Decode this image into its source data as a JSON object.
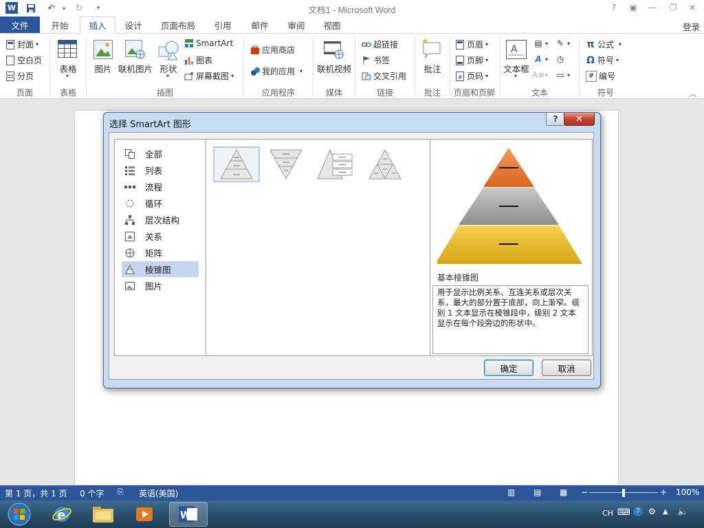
{
  "window": {
    "title": "文档1 - Microsoft Word",
    "controls": [
      "?",
      "▣",
      "—",
      "❐",
      "✕"
    ]
  },
  "tabs": {
    "file": "文件",
    "items": [
      "开始",
      "插入",
      "设计",
      "页面布局",
      "引用",
      "邮件",
      "审阅",
      "视图"
    ],
    "active": "插入",
    "login": "登录"
  },
  "ribbon": {
    "pages": {
      "cover": "封面",
      "blank": "空白页",
      "break": "分页",
      "label": "页面"
    },
    "tables": {
      "table": "表格",
      "label": "表格"
    },
    "illustrations": {
      "picture": "图片",
      "online_picture": "联机图片",
      "shapes": "形状",
      "smartart": "SmartArt",
      "chart": "图表",
      "screenshot": "屏幕截图",
      "label": "插图"
    },
    "apps": {
      "store": "应用商店",
      "myapps": "我的应用",
      "label": "应用程序"
    },
    "media": {
      "online_video": "联机视频",
      "label": "媒体"
    },
    "links": {
      "hyperlink": "超链接",
      "bookmark": "书签",
      "crossref": "交叉引用",
      "label": "链接"
    },
    "comments": {
      "comment": "批注",
      "label": "批注"
    },
    "header_footer": {
      "header": "页眉",
      "footer": "页脚",
      "page_number": "页码",
      "label": "页眉和页脚"
    },
    "text": {
      "textbox": "文本框",
      "label": "文本"
    },
    "symbols": {
      "equation": "公式",
      "symbol": "符号",
      "number": "编号",
      "label": "符号"
    }
  },
  "dialog": {
    "title": "选择 SmartArt 图形",
    "categories": [
      {
        "label": "全部",
        "icon": "all-icon"
      },
      {
        "label": "列表",
        "icon": "list-icon"
      },
      {
        "label": "流程",
        "icon": "process-icon"
      },
      {
        "label": "循环",
        "icon": "cycle-icon"
      },
      {
        "label": "层次结构",
        "icon": "hierarchy-icon"
      },
      {
        "label": "关系",
        "icon": "relationship-icon"
      },
      {
        "label": "矩阵",
        "icon": "matrix-icon"
      },
      {
        "label": "棱锥图",
        "icon": "pyramid-icon"
      },
      {
        "label": "图片",
        "icon": "picture-icon"
      }
    ],
    "selected_category": "棱锥图",
    "preview_title": "基本棱锥图",
    "description": "用于显示比例关系、互连关系或层次关系，最大的部分置于底部，向上渐窄。级别 1 文本显示在棱锥段中，级别 2 文本显示在每个段旁边的形状中。",
    "ok": "确定",
    "cancel": "取消",
    "colors": {
      "top": "#e8752c",
      "middle": "#9a9a9a",
      "bottom": "#f0be1e"
    }
  },
  "statusbar": {
    "page": "第 1 页，共 1 页",
    "words": "0 个字",
    "language": "英语(美国)",
    "zoom": "100%",
    "zoom_level": 0.5
  },
  "taskbar": {
    "tray_lang": "CH"
  }
}
